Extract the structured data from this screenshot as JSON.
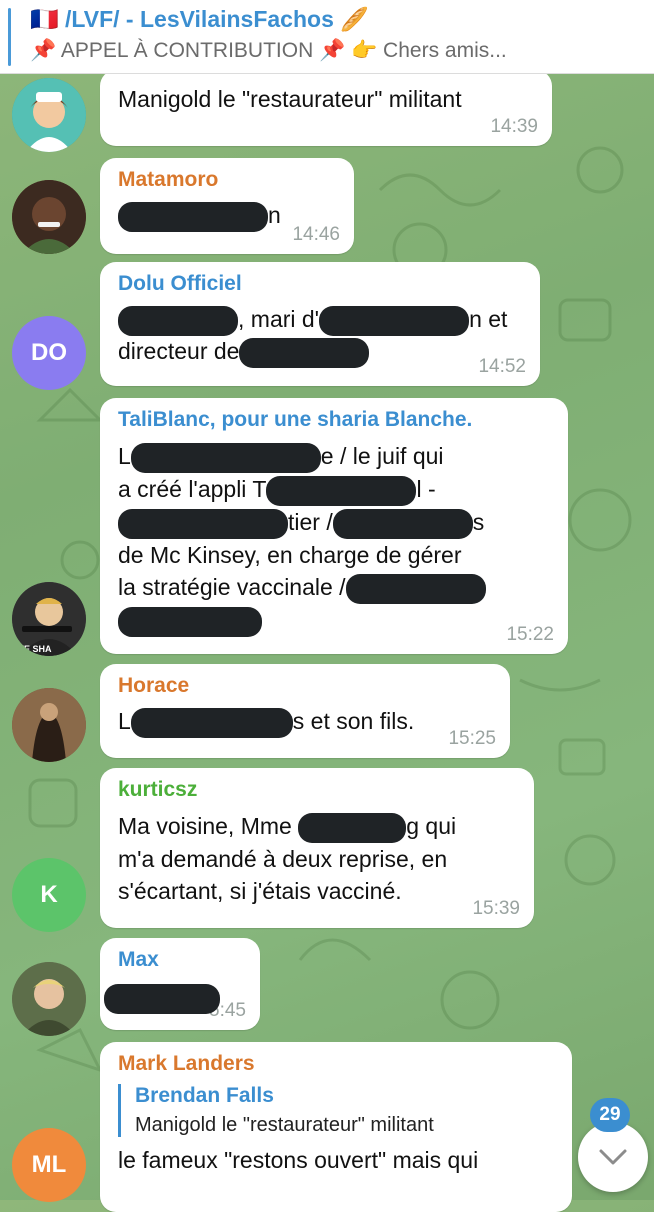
{
  "pinned": {
    "title": "🇫🇷 /LVF/ - LesVilainsFachos 🥖",
    "subtitle": "📌 APPEL À CONTRIBUTION 📌 👉 Chers amis..."
  },
  "messages": [
    {
      "sender": "",
      "text": "Manigold le \"restaurateur\" militant",
      "time": "14:39"
    },
    {
      "sender": "Matamoro",
      "text": "n",
      "time": "14:46"
    },
    {
      "sender": "Dolu Officiel",
      "avatar_initials": "DO",
      "text_parts": [
        ", mari d'",
        "n et",
        "directeur de"
      ],
      "time": "14:52"
    },
    {
      "sender": "TaliBlanc, pour une sharia Blanche.",
      "text_parts": [
        "L",
        "e / le juif qui",
        "a créé l'appli T",
        "l -",
        "tier /",
        "s",
        "de Mc Kinsey, en charge de gérer",
        "la stratégie vaccinale /"
      ],
      "time": "15:22"
    },
    {
      "sender": "Horace",
      "text_parts": [
        "L",
        "s et son fils."
      ],
      "time": "15:25"
    },
    {
      "sender": "kurticsz",
      "avatar_initials": "K",
      "text_parts": [
        "Ma voisine, Mme",
        "g qui",
        "m'a demandé à deux reprise, en",
        "s'écartant, si j'étais vacciné."
      ],
      "time": "15:39"
    },
    {
      "sender": "Max",
      "time": "15:45",
      "time_visible": "5:45"
    },
    {
      "sender": "Mark Landers",
      "avatar_initials": "ML",
      "reply_to": {
        "name": "Brendan Falls",
        "text": "Manigold le \"restaurateur\" militant"
      },
      "text": "le fameux \"restons ouvert\" mais qui"
    }
  ],
  "unread_count": "29",
  "colors": {
    "accent": "#3b8ed0",
    "matamoro": "#d9782d",
    "dolu": "#3b8ed0",
    "taliblanc": "#3b8ed0",
    "horace": "#d9782d",
    "kurticsz": "#4caf3a",
    "max": "#3b8ed0",
    "mark": "#d9782d",
    "avatar_do": "#8a7cf0",
    "avatar_k": "#5cc46a",
    "avatar_ml": "#f08a3c"
  }
}
